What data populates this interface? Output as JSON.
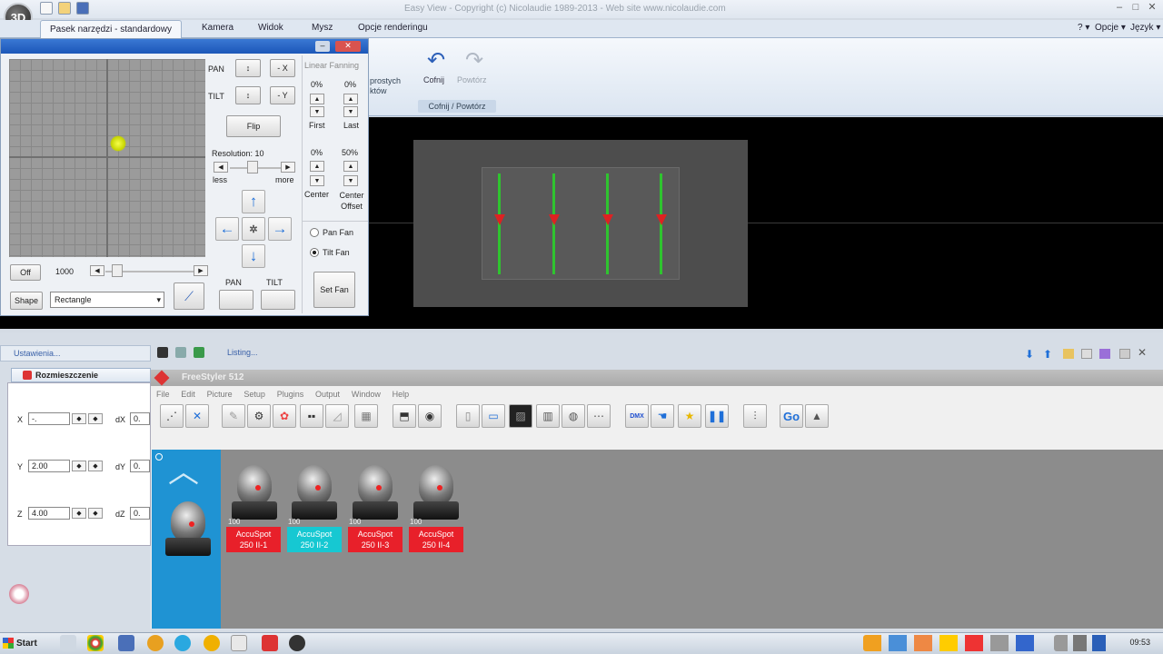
{
  "window": {
    "title": "Easy View - Copyright (c) Nicolaudie 1989-2013 - Web site www.nicolaudie.com",
    "logo": "3D",
    "right_menu": {
      "help": "? ▾",
      "options": "Opcje ▾",
      "language": "Język ▾"
    }
  },
  "ribbon": {
    "tabs": [
      "Pasek narzędzi - standardowy",
      "Kamera",
      "Widok",
      "Mysz",
      "Opcje renderingu"
    ],
    "active_tab": "Pasek narzędzi - standardowy",
    "partial_label": "prostych\nktów",
    "undo_label": "Cofnij",
    "redo_label": "Powtórz",
    "group_label": "Cofnij / Powtórz"
  },
  "pantilt": {
    "pan_label": "PAN",
    "tilt_label": "TILT",
    "minus_x": "- X",
    "minus_y": "- Y",
    "flip": "Flip",
    "resolution": "Resolution: 10",
    "less": "less",
    "more": "more",
    "off": "Off",
    "speed_value": "1000",
    "shape_button": "Shape",
    "shape_value": "Rectangle",
    "pan_small": "PAN",
    "tilt_small": "TILT",
    "linear_fanning": "Linear Fanning",
    "first_pct": "0%",
    "last_pct": "0%",
    "first": "First",
    "last": "Last",
    "center_pct": "0%",
    "offset_pct": "50%",
    "center": "Center",
    "center_offset": "Center Offset",
    "pan_fan": "Pan Fan",
    "tilt_fan": "Tilt Fan",
    "set_fan": "Set Fan"
  },
  "bottom": {
    "left_panel_tab": "Ustawienia...",
    "listing_tab": "Listing...",
    "placement_tab": "Rozmieszczenie",
    "x_label": "X",
    "x_value": "-.",
    "y_label": "Y",
    "y_value": "2.00",
    "z_label": "Z",
    "z_value": "4.00",
    "dx_label": "dX",
    "dy_label": "dY",
    "dz_label": "dZ",
    "d_value": "0."
  },
  "freestyler": {
    "caption": "FreeStyler 512",
    "menu": [
      "File",
      "Edit",
      "Picture",
      "Setup",
      "Plugins",
      "Output",
      "Window",
      "Help"
    ],
    "go_label": "Go",
    "dmx_label": "DMX",
    "fixtures": [
      {
        "line1": "AccuSpot",
        "line2": "250 II-1",
        "color": "#e8202a"
      },
      {
        "line1": "AccuSpot",
        "line2": "250 II-2",
        "color": "#16c8d2"
      },
      {
        "line1": "AccuSpot",
        "line2": "250 II-3",
        "color": "#e8202a"
      },
      {
        "line1": "AccuSpot",
        "line2": "250 II-4",
        "color": "#e8202a"
      }
    ],
    "fixture_prefix": "100"
  },
  "taskbar": {
    "start": "Start",
    "clock": "09:53"
  }
}
